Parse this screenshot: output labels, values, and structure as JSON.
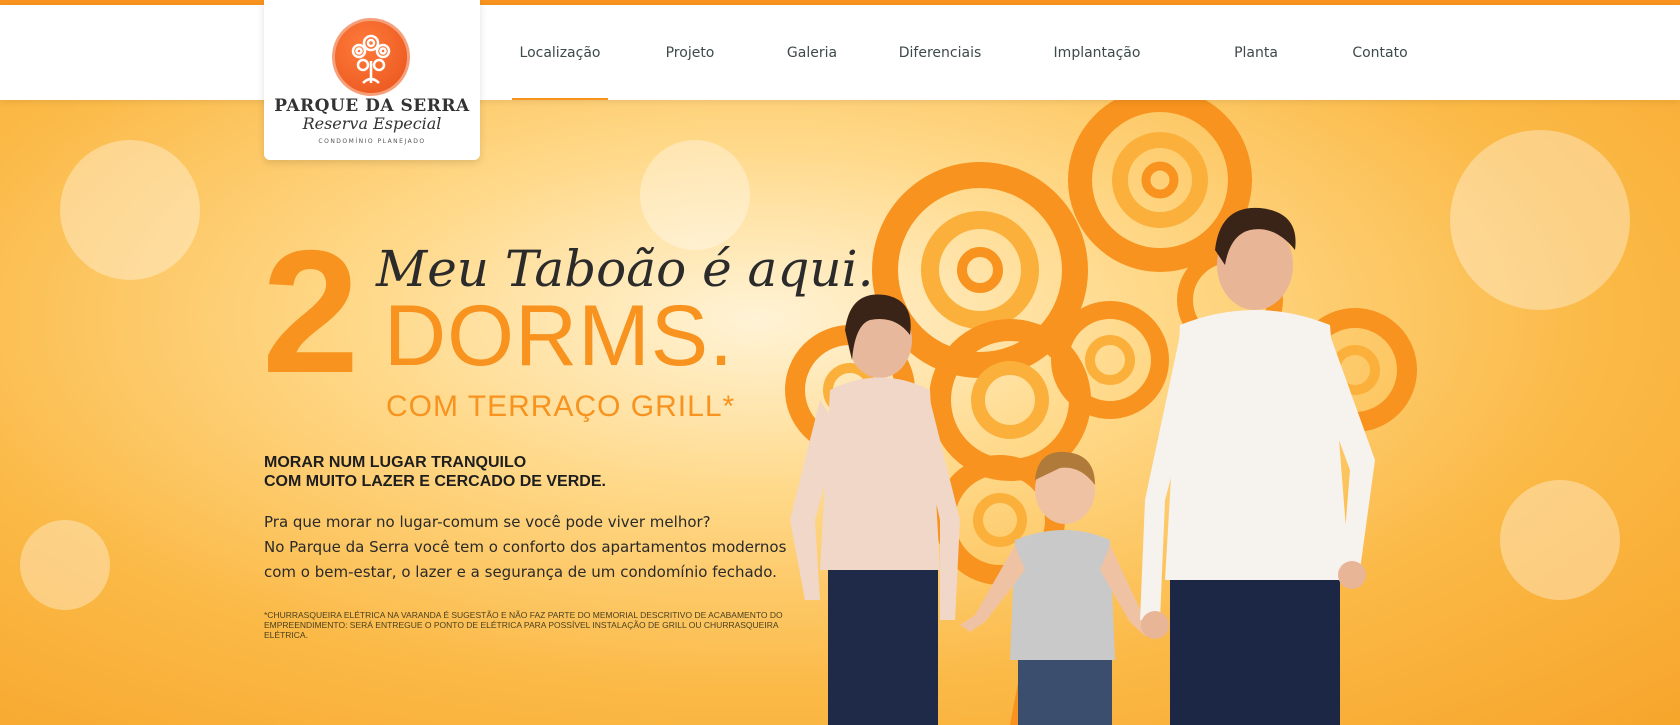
{
  "brand": {
    "name": "PARQUE DA SERRA",
    "subtitle": "Reserva Especial",
    "tagline": "CONDOMÍNIO PLANEJADO"
  },
  "nav": {
    "items": [
      {
        "label": "Localização",
        "active": true
      },
      {
        "label": "Projeto",
        "active": false
      },
      {
        "label": "Galeria",
        "active": false
      },
      {
        "label": "Diferenciais",
        "active": false
      },
      {
        "label": "Implantação",
        "active": false
      },
      {
        "label": "Planta",
        "active": false
      },
      {
        "label": "Contato",
        "active": false
      }
    ]
  },
  "hero": {
    "number": "2",
    "script_line": "Meu Taboão é aqui.",
    "dorms": "DORMS.",
    "grill": "COM TERRAÇO GRILL*",
    "headline_1": "MORAR NUM LUGAR TRANQUILO",
    "headline_2": "COM MUITO LAZER E CERCADO DE VERDE.",
    "para_1": "Pra que morar no lugar-comum se você pode viver melhor?",
    "para_2": "No Parque da Serra você tem o conforto dos apartamentos modernos",
    "para_3": "com o bem-estar, o lazer e a segurança de um condomínio fechado.",
    "footnote": "*Churrasqueira elétrica na varanda é sugestão e não faz parte do memorial descritivo de acabamento do empreendimento: será entregue o ponto de elétrica para possível instalação de grill ou churrasqueira elétrica."
  },
  "colors": {
    "accent": "#f7931e",
    "logo": "#e8531c",
    "text": "#1e1e1e"
  }
}
